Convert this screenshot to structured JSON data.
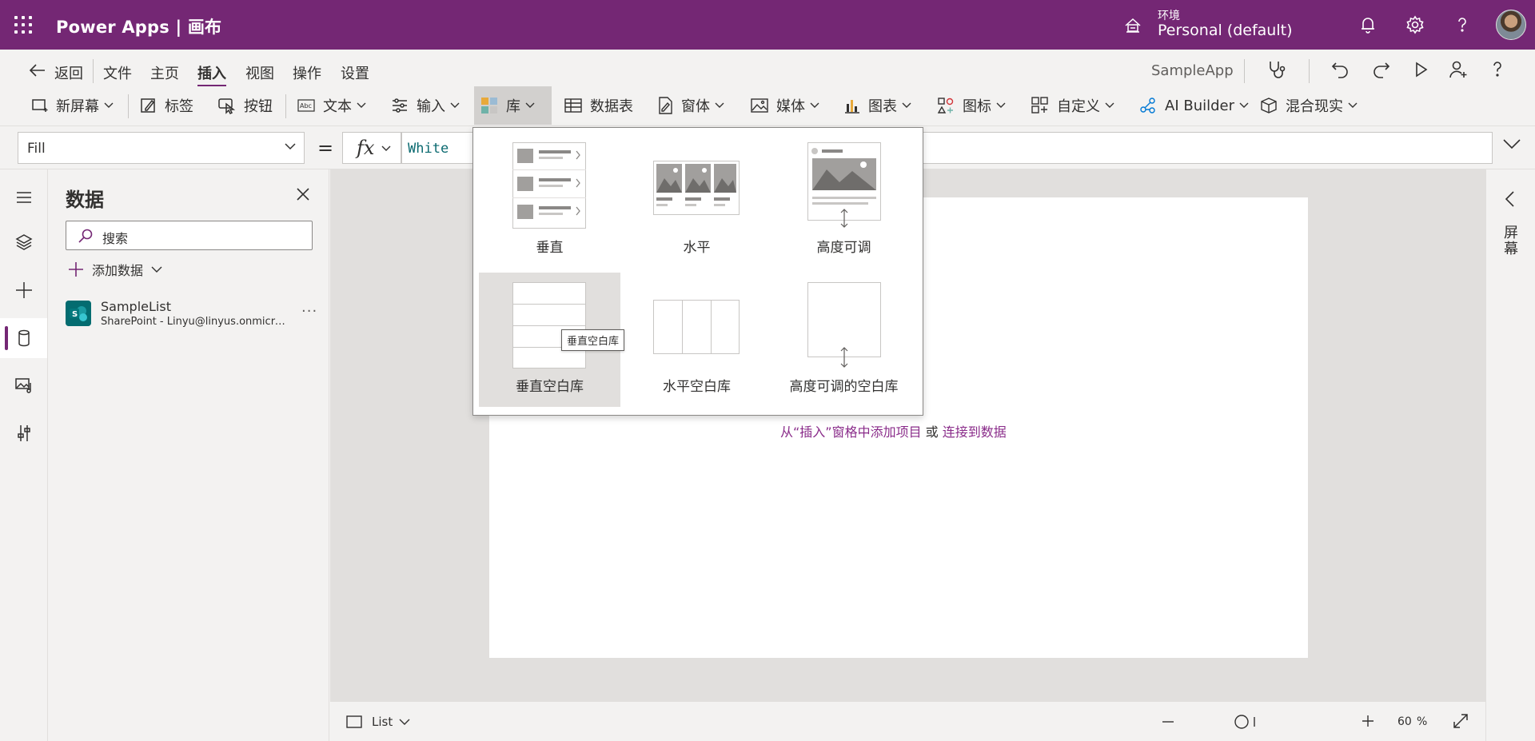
{
  "header": {
    "brand": "Power Apps  |  画布",
    "env_label": "环境",
    "env_name": "Personal (default)"
  },
  "menu": {
    "back": "返回",
    "items": [
      "文件",
      "主页",
      "插入",
      "视图",
      "操作",
      "设置"
    ],
    "active": "插入",
    "app_name": "SampleApp"
  },
  "ribbon": {
    "new_screen": "新屏幕",
    "label": "标签",
    "button": "按钮",
    "text": "文本",
    "input": "输入",
    "gallery": "库",
    "data_table": "数据表",
    "forms": "窗体",
    "media": "媒体",
    "charts": "图表",
    "icons": "图标",
    "custom": "自定义",
    "ai_builder": "AI Builder",
    "mixed_reality": "混合现实"
  },
  "formula_bar": {
    "property": "Fill",
    "fx": "fx",
    "formula": "White"
  },
  "data_panel": {
    "title": "数据",
    "search_placeholder": "搜索",
    "add_data": "添加数据",
    "sources": [
      {
        "name": "SampleList",
        "detail": "SharePoint - Linyu@linyus.onmicrosoft.com"
      }
    ]
  },
  "gallery_menu": {
    "items": [
      {
        "label": "垂直",
        "type": "vertical"
      },
      {
        "label": "水平",
        "type": "horizontal"
      },
      {
        "label": "高度可调",
        "type": "flexible-height"
      },
      {
        "label": "垂直空白库",
        "type": "blank-vertical"
      },
      {
        "label": "水平空白库",
        "type": "blank-horizontal"
      },
      {
        "label": "高度可调的空白库",
        "type": "blank-flexible-height"
      }
    ],
    "tooltip": "垂直空白库"
  },
  "canvas": {
    "hint_link1": "从“插入”窗格中添加项目",
    "hint_mid": " 或 ",
    "hint_link2": "连接到数据"
  },
  "right_panel": {
    "label": "屏幕"
  },
  "bottom_bar": {
    "screen_name": "List",
    "zoom": "60",
    "zoom_unit": "%"
  },
  "colors": {
    "brand_purple": "#742774",
    "link_purple": "#8a2c8a",
    "formula_teal": "#0b6a70",
    "sharepoint_teal": "#036c70"
  }
}
